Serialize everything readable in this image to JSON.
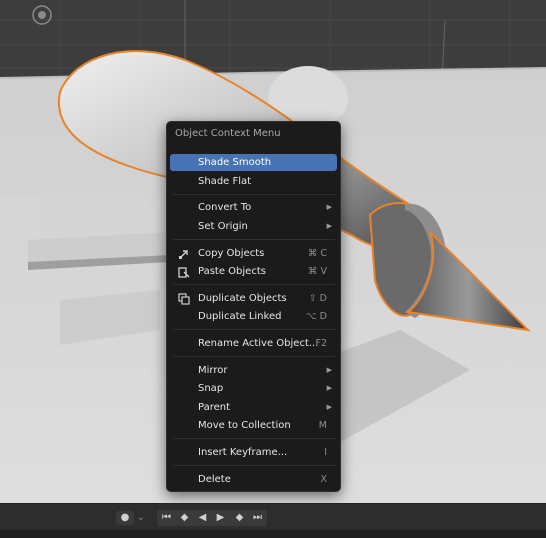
{
  "menu": {
    "title": "Object Context Menu",
    "items": [
      {
        "label": "Shade Smooth",
        "highlighted": true
      },
      {
        "label": "Shade Flat"
      },
      {
        "label": "Convert To",
        "submenu": true
      },
      {
        "label": "Set Origin",
        "submenu": true
      },
      {
        "label": "Copy Objects",
        "shortcut": "⌘ C",
        "icon": "copy-icon"
      },
      {
        "label": "Paste Objects",
        "shortcut": "⌘ V",
        "icon": "paste-icon"
      },
      {
        "label": "Duplicate Objects",
        "shortcut": "⇧ D",
        "icon": "duplicate-icon"
      },
      {
        "label": "Duplicate Linked",
        "shortcut": "⌥ D"
      },
      {
        "label": "Rename Active Object...",
        "shortcut": "F2"
      },
      {
        "label": "Mirror",
        "submenu": true
      },
      {
        "label": "Snap",
        "submenu": true
      },
      {
        "label": "Parent",
        "submenu": true
      },
      {
        "label": "Move to Collection",
        "shortcut": "M"
      },
      {
        "label": "Insert Keyframe...",
        "shortcut": "I"
      },
      {
        "label": "Delete",
        "shortcut": "X"
      }
    ],
    "submenu_arrow": "▶"
  },
  "colors": {
    "highlight": "#4772b3",
    "selection_outline": "#e8832a",
    "menu_bg": "#1b1b1b"
  },
  "playback": {
    "buttons": [
      "record-icon",
      "jump-start-icon",
      "prev-keyframe-icon",
      "play-reverse-icon",
      "play-icon",
      "next-keyframe-icon",
      "jump-end-icon"
    ]
  }
}
